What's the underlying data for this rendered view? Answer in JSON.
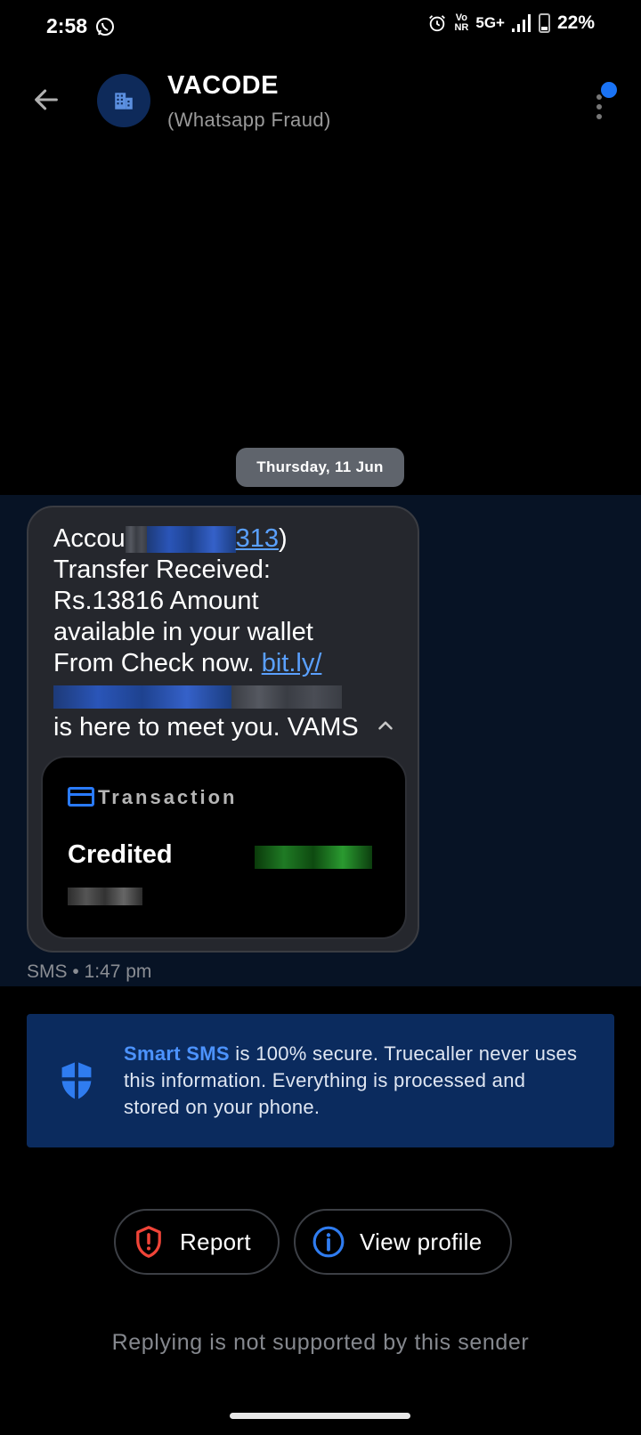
{
  "status_bar": {
    "time": "2:58",
    "whatsapp_icon": "whatsapp-icon",
    "alarm_icon": "alarm-icon",
    "volte_top": "Vo",
    "volte_bottom": "NR",
    "network": "5G+",
    "signal_icon": "signal-icon",
    "battery_icon": "battery-icon",
    "battery": "22%"
  },
  "header": {
    "back_icon": "arrow-left-icon",
    "avatar_icon": "building-icon",
    "title": "VACODE",
    "subtitle": "(Whatsapp Fraud)",
    "menu_icon": "more-vert-icon",
    "badge_color": "#1a73f5"
  },
  "date_chip": "Thursday, 11 Jun",
  "message": {
    "line1_start": "Accou",
    "line1_link_end": "313",
    "line1_end": ")",
    "line2": "Transfer Received:",
    "line3": "Rs.13816 Amount",
    "line4": "available in your wallet",
    "line5_text": "From Check now.",
    "line5_link": "bit.ly/",
    "line7": "is here to meet you. VAMS",
    "collapse_icon": "chevron-up-icon",
    "meta": "SMS • 1:47 pm",
    "link_color": "#5aa0ff"
  },
  "transaction_card": {
    "icon": "credit-card-icon",
    "label": "Transaction",
    "status": "Credited"
  },
  "smart_sms": {
    "icon": "shield-icon",
    "highlight": "Smart SMS",
    "text": " is 100% secure. Truecaller never uses this information. Everything is processed and stored on your phone.",
    "highlight_color": "#4c93ff"
  },
  "actions": {
    "report_label": "Report",
    "report_icon": "report-shield-icon",
    "view_profile_label": "View profile",
    "view_profile_icon": "info-icon"
  },
  "reply_note": "Replying is not supported by this sender"
}
